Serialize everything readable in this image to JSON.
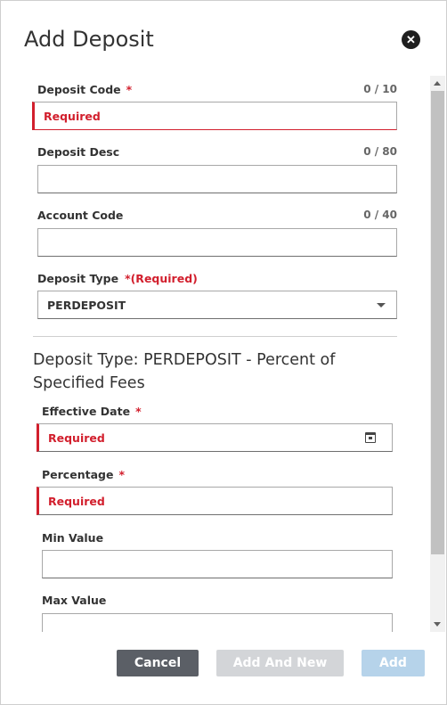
{
  "dialog": {
    "title": "Add Deposit"
  },
  "form": {
    "deposit_code": {
      "label": "Deposit Code",
      "required_mark": "*",
      "counter": "0 / 10",
      "placeholder": "Required",
      "value": ""
    },
    "deposit_desc": {
      "label": "Deposit Desc",
      "counter": "0 / 80",
      "value": ""
    },
    "account_code": {
      "label": "Account Code",
      "counter": "0 / 40",
      "value": ""
    },
    "deposit_type": {
      "label": "Deposit Type",
      "required_mark": "*(Required)",
      "selected": "PERDEPOSIT"
    }
  },
  "section": {
    "title": "Deposit Type: PERDEPOSIT - Percent of Specified Fees",
    "effective_date": {
      "label": "Effective Date",
      "required_mark": "*",
      "placeholder": "Required"
    },
    "percentage": {
      "label": "Percentage",
      "required_mark": "*",
      "placeholder": "Required"
    },
    "min_value": {
      "label": "Min Value",
      "value": ""
    },
    "max_value": {
      "label": "Max Value",
      "value": ""
    }
  },
  "footer": {
    "cancel_label": "Cancel",
    "add_and_new_label": "Add And New",
    "add_label": "Add"
  },
  "colors": {
    "error": "#d21f2d",
    "cancel_bg": "#5b5f66",
    "add_and_new_bg": "#d3d5d8",
    "add_bg": "#b6d3ea"
  },
  "icons": [
    "close-icon",
    "calendar-icon",
    "chevron-down-icon",
    "scroll-up-icon",
    "scroll-down-icon"
  ]
}
